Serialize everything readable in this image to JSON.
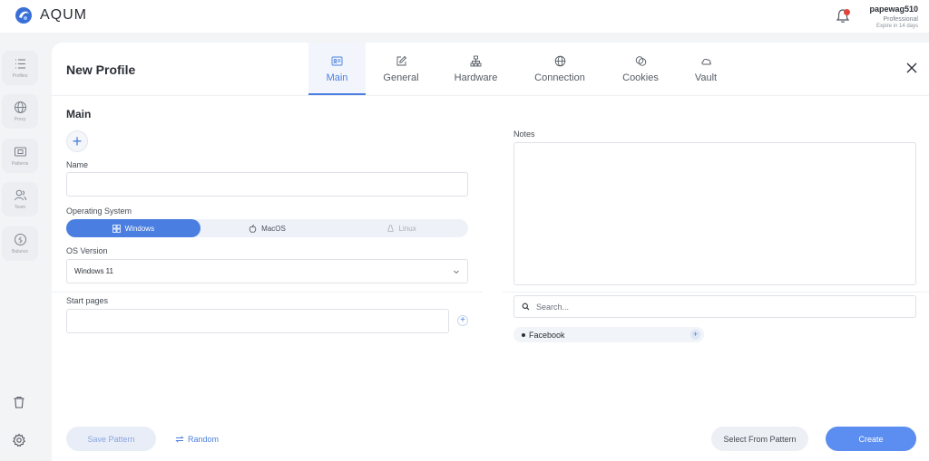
{
  "app": {
    "name": "AQUM"
  },
  "user": {
    "name": "papewag510",
    "plan": "Professional",
    "expiry": "Expire in 14 days"
  },
  "sidebar": {
    "items": [
      {
        "label": "Profiles",
        "icon": "list-icon"
      },
      {
        "label": "Proxy",
        "icon": "globe-icon"
      },
      {
        "label": "Patterns",
        "icon": "pattern-icon"
      },
      {
        "label": "Team",
        "icon": "team-icon"
      },
      {
        "label": "Balance",
        "icon": "dollar-icon"
      }
    ],
    "bottom_icons": [
      "trash-icon",
      "gear-icon"
    ]
  },
  "dialog": {
    "title": "New Profile",
    "tabs": [
      {
        "label": "Main",
        "icon": "id-card-icon",
        "active": true
      },
      {
        "label": "General",
        "icon": "edit-icon",
        "active": false
      },
      {
        "label": "Hardware",
        "icon": "hardware-icon",
        "active": false
      },
      {
        "label": "Connection",
        "icon": "globe-icon",
        "active": false
      },
      {
        "label": "Cookies",
        "icon": "cookies-icon",
        "active": false
      },
      {
        "label": "Vault",
        "icon": "cloud-icon",
        "active": false
      }
    ],
    "section_title": "Main",
    "name_label": "Name",
    "name_value": "",
    "os_label": "Operating System",
    "os_options": [
      {
        "label": "Windows",
        "icon": "windows-icon",
        "state": "active"
      },
      {
        "label": "MacOS",
        "icon": "apple-icon",
        "state": "normal"
      },
      {
        "label": "Linux",
        "icon": "linux-icon",
        "state": "disabled"
      }
    ],
    "os_version_label": "OS Version",
    "os_version_value": "Windows 11",
    "start_pages_label": "Start pages",
    "notes_label": "Notes",
    "search_placeholder": "Search...",
    "tags": [
      {
        "label": "Facebook"
      }
    ],
    "buttons": {
      "save_pattern": "Save Pattern",
      "random": "Random",
      "select_from_pattern": "Select From Pattern",
      "create": "Create"
    }
  },
  "colors": {
    "accent": "#4a7ee0",
    "create_button": "#5b8ef0",
    "badge": "#e0453c"
  }
}
